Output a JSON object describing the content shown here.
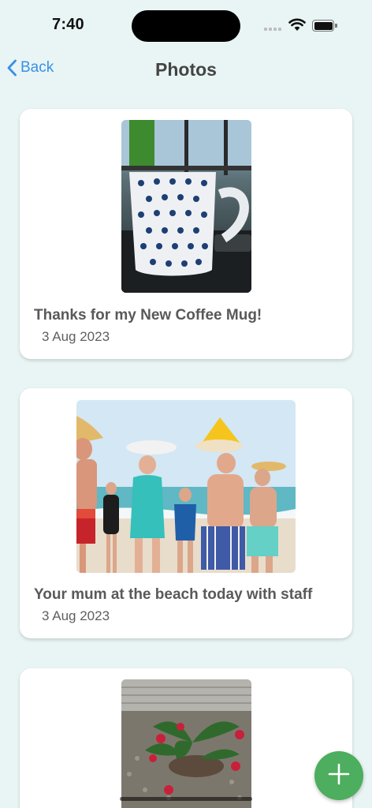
{
  "status_bar": {
    "time": "7:40",
    "icons": [
      "cellular-signal-icon",
      "wifi-icon",
      "battery-icon"
    ]
  },
  "nav": {
    "back_label": "Back",
    "title": "Photos"
  },
  "photos": [
    {
      "caption": "Thanks for my New Coffee Mug!",
      "date": "3 Aug 2023",
      "image": "polka-dot coffee mug on desk"
    },
    {
      "caption": "Your mum at the beach today with staff",
      "date": "3 Aug 2023",
      "image": "group of seniors at the beach holding surfboards"
    },
    {
      "caption": "",
      "date": "",
      "image": "potted red flowers in garden"
    }
  ],
  "fab": {
    "icon": "plus-icon"
  },
  "colors": {
    "background": "#e8f5f4",
    "accent_link": "#3b8fe8",
    "fab": "#4cae5e",
    "card": "#ffffff"
  }
}
